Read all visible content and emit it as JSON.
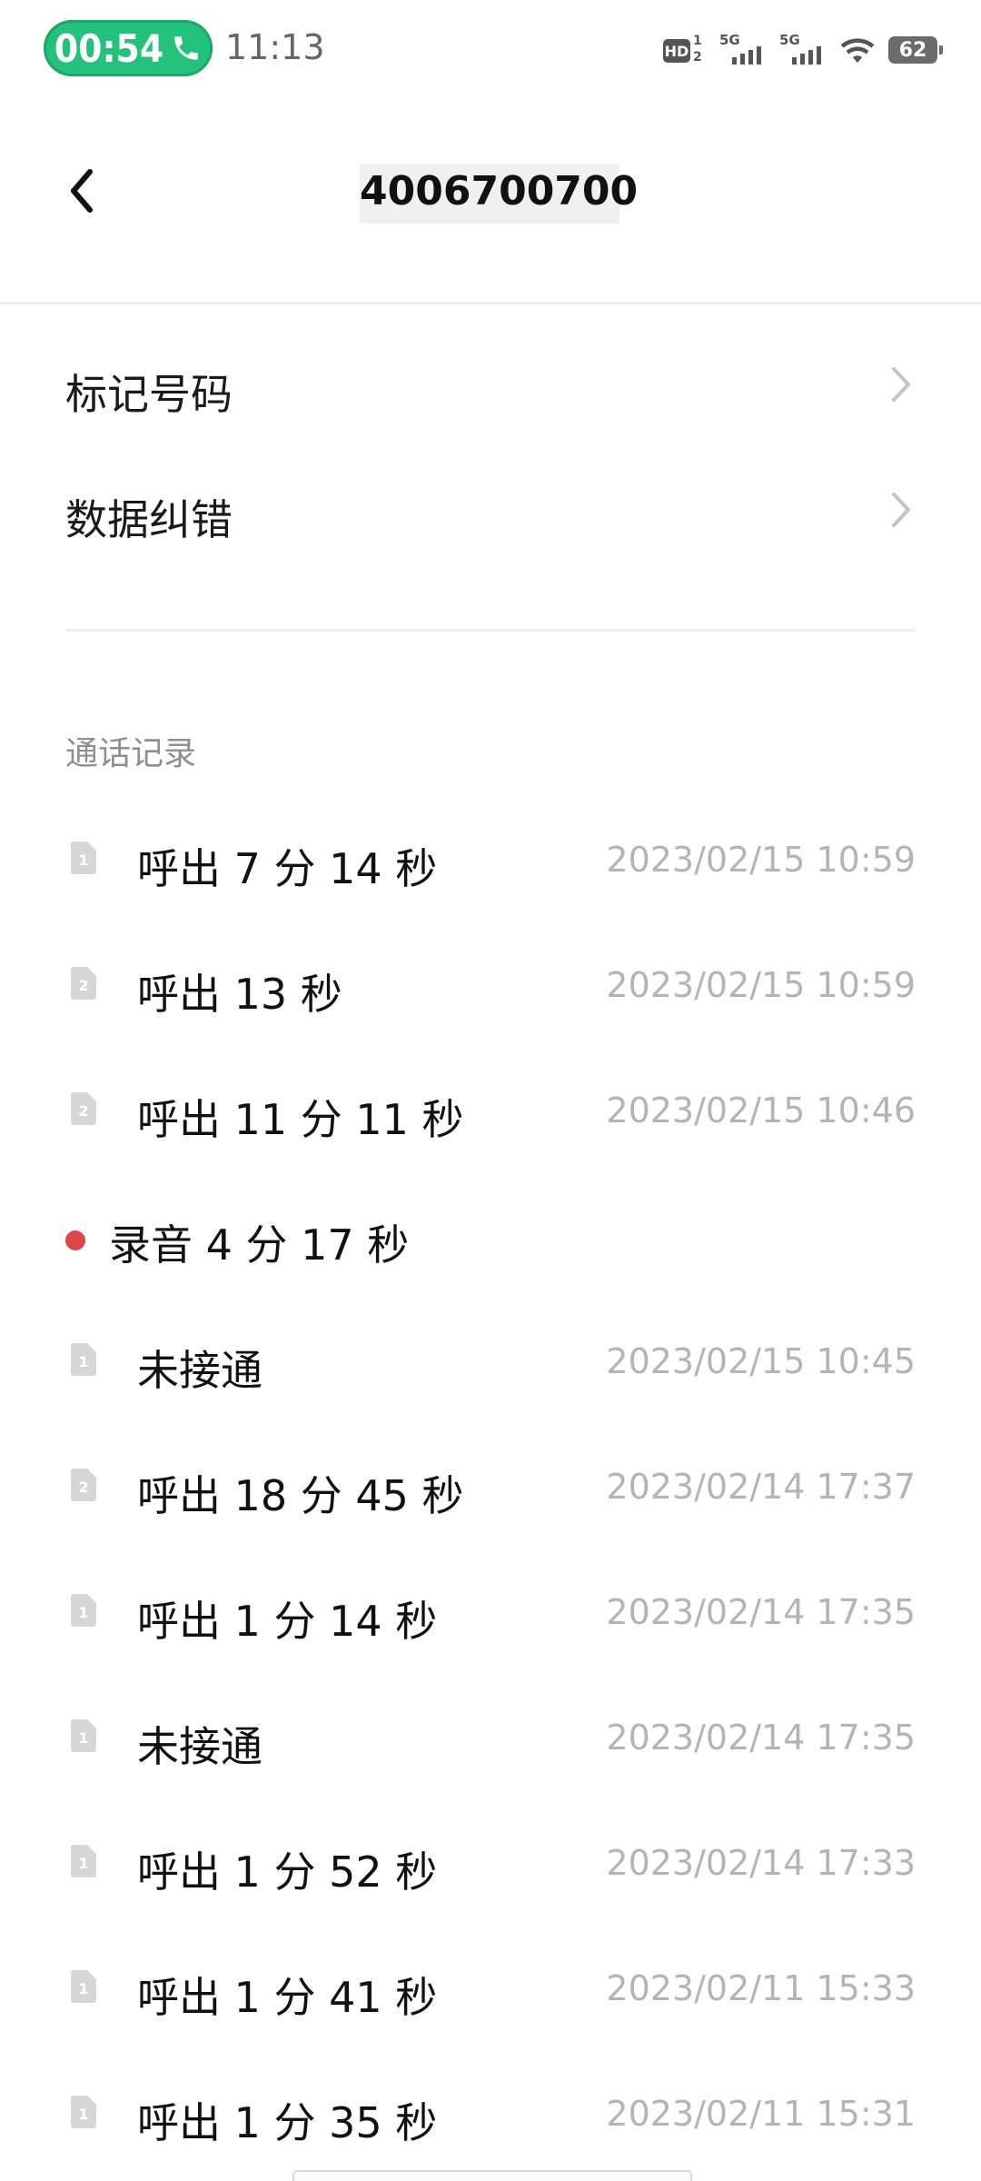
{
  "status_bar": {
    "call_timer": "00:54",
    "clock": "11:13",
    "hd_label": "HD",
    "hd_sup": "1",
    "hd_sub": "2",
    "sim1_network": "5G",
    "sim2_network": "5G",
    "battery": "62",
    "call_pill_color": "#22c27a"
  },
  "header": {
    "title": "4006700700",
    "back_icon": "back-arrow-icon"
  },
  "menu": [
    {
      "label": "标记号码",
      "icon": "chevron-right-icon"
    },
    {
      "label": "数据纠错",
      "icon": "chevron-right-icon"
    }
  ],
  "call_log": {
    "section_title": "通话记录",
    "records": [
      {
        "sim": "1",
        "type": "呼出 7 分 14 秒",
        "time": "2023/02/15 10:59"
      },
      {
        "sim": "2",
        "type": "呼出 13 秒",
        "time": "2023/02/15 10:59"
      },
      {
        "sim": "2",
        "type": "呼出 11 分 11 秒",
        "time": "2023/02/15 10:46"
      },
      {
        "recording": true,
        "type": "录音 4 分 17 秒",
        "time": ""
      },
      {
        "sim": "1",
        "type": "未接通",
        "time": "2023/02/15 10:45"
      },
      {
        "sim": "2",
        "type": "呼出 18 分 45 秒",
        "time": "2023/02/14 17:37"
      },
      {
        "sim": "1",
        "type": "呼出 1 分 14 秒",
        "time": "2023/02/14 17:35"
      },
      {
        "sim": "1",
        "type": "未接通",
        "time": "2023/02/14 17:35"
      },
      {
        "sim": "1",
        "type": "呼出 1 分 52 秒",
        "time": "2023/02/14 17:33"
      },
      {
        "sim": "1",
        "type": "呼出 1 分 41 秒",
        "time": "2023/02/11 15:33"
      },
      {
        "sim": "1",
        "type": "呼出 1 分 35 秒",
        "time": "2023/02/11 15:31"
      }
    ],
    "recording_dot_color": "#e0454a"
  }
}
